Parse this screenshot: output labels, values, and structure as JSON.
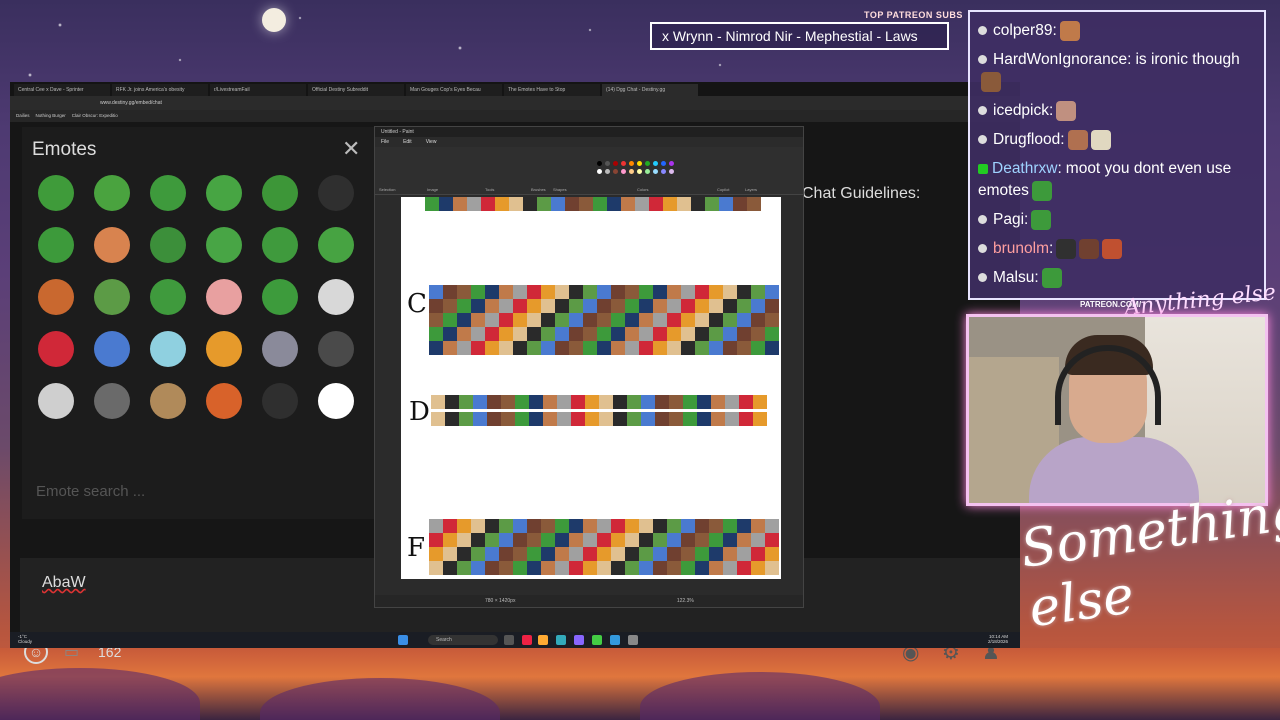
{
  "overlay": {
    "patreon_header": "TOP PATREON SUBS",
    "sub_ticker": "x Wrynn - Nimrod Nir - Mephestial - Laws",
    "patreon_url": "PATREON.COM/",
    "brand": "Something else",
    "brand_small": "Anything else"
  },
  "browser": {
    "tabs": [
      "Central Cee x Dave - Sprinter",
      "RFK Jr. joins America's obesity",
      "r/LivestreamFail",
      "Official Destiny Subreddit",
      "Man Gouges Cop's Eyes Becau",
      "The Emotes Have to Stop",
      "(14) Dgg Chat - Destiny.gg"
    ],
    "url": "www.destiny.gg/embed/chat",
    "bookmarks": [
      "Dailies",
      "Nothing Burger",
      "Clair Obscur: Expeditio"
    ]
  },
  "emote_panel": {
    "title": "Emotes",
    "search_placeholder": "Emote search ...",
    "emote_colors": [
      "#3f9b3a",
      "#4aa33f",
      "#3e9a3c",
      "#47a543",
      "#3d9638",
      "#2f2f2f",
      "#3d9a3b",
      "#d8834f",
      "#3c8f3a",
      "#48a545",
      "#3f9a3d",
      "#47a342",
      "#c9682f",
      "#5c9b46",
      "#3f9a3d",
      "#e8a0a0",
      "#3d9b3c",
      "#d8d8d8",
      "#d02838",
      "#4a7ad0",
      "#8fd0e0",
      "#e69a2b",
      "#8a8a9a",
      "#4a4a4a",
      "#cfcfcf",
      "#6a6a6a",
      "#b08a5a",
      "#d8622a",
      "#2f2f2f",
      "#ffffff"
    ]
  },
  "behind": {
    "guidelines": "Chat Guidelines:"
  },
  "chat_input": {
    "text": "AbaW",
    "user_count": "162"
  },
  "paint": {
    "title": "Untitled - Paint",
    "menu": [
      "File",
      "Edit",
      "View"
    ],
    "ribbon_labels": [
      "Selection",
      "Image",
      "Tools",
      "Brushes",
      "Shapes",
      "Colors",
      "Copilot",
      "Layers"
    ],
    "tiers": [
      "C",
      "D",
      "F"
    ],
    "status_size": "780 × 1420px",
    "zoom": "122.3%"
  },
  "taskbar": {
    "search": "Search",
    "weather_temp": "-1°C",
    "weather_desc": "Cloudy",
    "time": "10:14 AM",
    "date": "2/18/2026"
  },
  "chat": {
    "messages": [
      {
        "user": "colper89",
        "color": "#ffffff",
        "text": "",
        "emotes": [
          "#c07a4a"
        ]
      },
      {
        "user": "HardWonIgnorance",
        "color": "#ffffff",
        "text": "is ironic though",
        "emotes": [
          "#8a5a3a"
        ]
      },
      {
        "user": "icedpick",
        "color": "#ffffff",
        "text": "",
        "emotes": [
          "#c09080"
        ]
      },
      {
        "user": "Drugflood",
        "color": "#ffffff",
        "text": "",
        "emotes": [
          "#b07050",
          "#e0d8c0"
        ]
      },
      {
        "user": "Deathrxw",
        "color": "#9fd3ff",
        "text": "moot you dont even use emotes",
        "emotes": [
          "#3d9a3b"
        ]
      },
      {
        "user": "Pagi",
        "color": "#ffffff",
        "text": "",
        "emotes": [
          "#3d9a3b"
        ]
      },
      {
        "user": "brunolm",
        "color": "#ff9f9f",
        "text": "",
        "emotes": [
          "#303030",
          "#704030",
          "#c05030"
        ]
      },
      {
        "user": "Malsu",
        "color": "#ffffff",
        "text": "",
        "emotes": [
          "#3d9a3b"
        ]
      }
    ]
  }
}
